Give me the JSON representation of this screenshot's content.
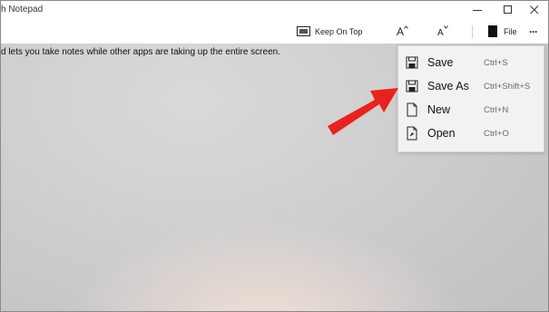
{
  "window": {
    "title": "h Notepad"
  },
  "toolbar": {
    "keep_on_top_label": "Keep On Top",
    "increase_font_glyph": "A",
    "decrease_font_glyph": "A",
    "file_label": "File",
    "more_glyph": "···"
  },
  "document": {
    "text": "d lets you take notes while other apps are taking up the entire screen."
  },
  "file_menu": {
    "items": [
      {
        "label": "Save",
        "shortcut": "Ctrl+S",
        "icon": "save-icon"
      },
      {
        "label": "Save As",
        "shortcut": "Ctrl+Shift+S",
        "icon": "save-as-icon"
      },
      {
        "label": "New",
        "shortcut": "Ctrl+N",
        "icon": "new-file-icon"
      },
      {
        "label": "Open",
        "shortcut": "Ctrl+O",
        "icon": "open-file-icon"
      }
    ]
  },
  "annotation": {
    "arrow_color": "#e8231f"
  }
}
